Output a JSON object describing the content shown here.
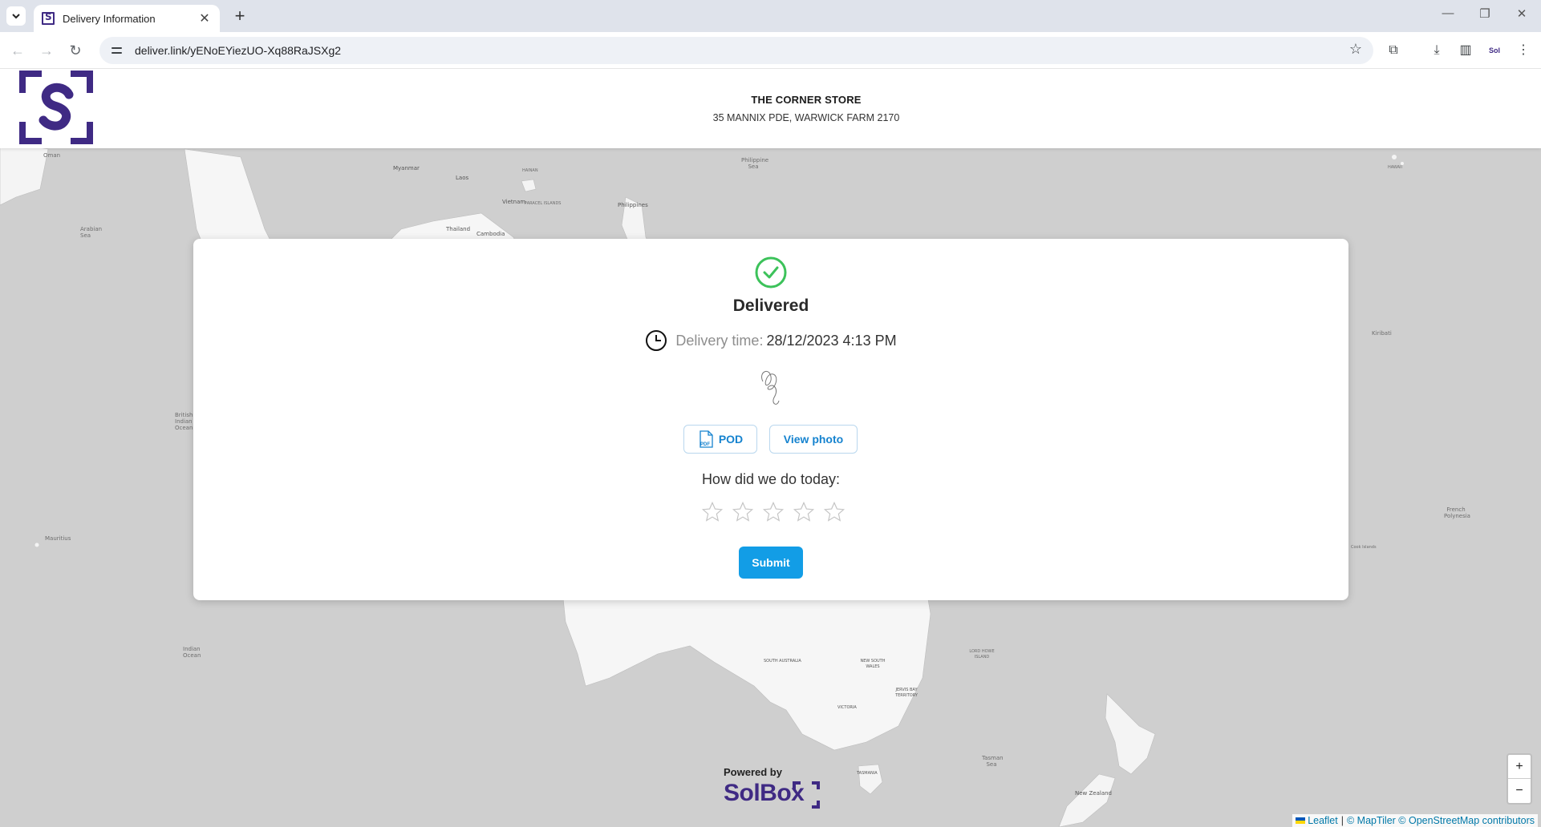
{
  "browser": {
    "tab_title": "Delivery Information",
    "url": "deliver.link/yENoEYiezUO-Xq88RaJSXg2",
    "icons": [
      "tab-dropdown-icon",
      "close-icon",
      "plus-icon",
      "back-icon",
      "forward-icon",
      "reload-icon",
      "site-info-icon",
      "star-icon",
      "extensions-icon",
      "download-icon",
      "side-panel-icon",
      "profile-icon",
      "menu-icon",
      "minimize-icon",
      "restore-icon",
      "window-close-icon"
    ]
  },
  "header": {
    "store_name": "THE CORNER STORE",
    "store_address": "35 MANNIX PDE, WARWICK FARM 2170"
  },
  "delivery": {
    "status": "Delivered",
    "time_label": "Delivery time:",
    "time_value": "28/12/2023 4:13 PM",
    "pod_label": "POD",
    "pdf_badge": "PDF",
    "photo_label": "View photo",
    "rating_question": "How did we do today:",
    "rating_max": 5,
    "rating_value": 0,
    "submit_label": "Submit",
    "status_color": "#3cc25a",
    "button_color": "#129de6"
  },
  "footer": {
    "powered_by": "Powered by",
    "brand": "SolBox",
    "brand_color": "#3f2a84"
  },
  "map": {
    "zoom_in": "+",
    "zoom_out": "−",
    "attribution_leaflet": "Leaflet",
    "attribution_sep": "|",
    "attribution_rest": "© MapTiler © OpenStreetMap contributors",
    "labels": {
      "oman": "Oman",
      "arabian_sea": "Arabian Sea",
      "myanmar": "Myanmar",
      "laos": "Laos",
      "hainan": "HAINAN",
      "vietnam": "Vietnam",
      "paracel": "PARACEL ISLANDS",
      "thailand": "Thailand",
      "cambodia": "Cambodia",
      "philippines": "Philippines",
      "philippine_sea": "Philippine Sea",
      "hawaii": "HAWAII",
      "kiribati": "Kiribati",
      "indian_ocean": "Indian Ocean",
      "british_indian": "British Indian Ocean Te",
      "mauritius": "Mauritius",
      "indian_ocean_2": "Indian Ocean",
      "french_polynesia": "French Polynesia",
      "cook_islands": "Cook Islands",
      "lord_howe": "LORD HOWE ISLAND",
      "south_australia": "SOUTH AUSTRALIA",
      "new_south_wales": "NEW SOUTH WALES",
      "jervis_bay": "JERVIS BAY TERRITORY",
      "victoria": "VICTORIA",
      "tasmania": "TASMANIA",
      "tasman_sea": "Tasman Sea",
      "new_zealand": "New Zealand"
    }
  }
}
